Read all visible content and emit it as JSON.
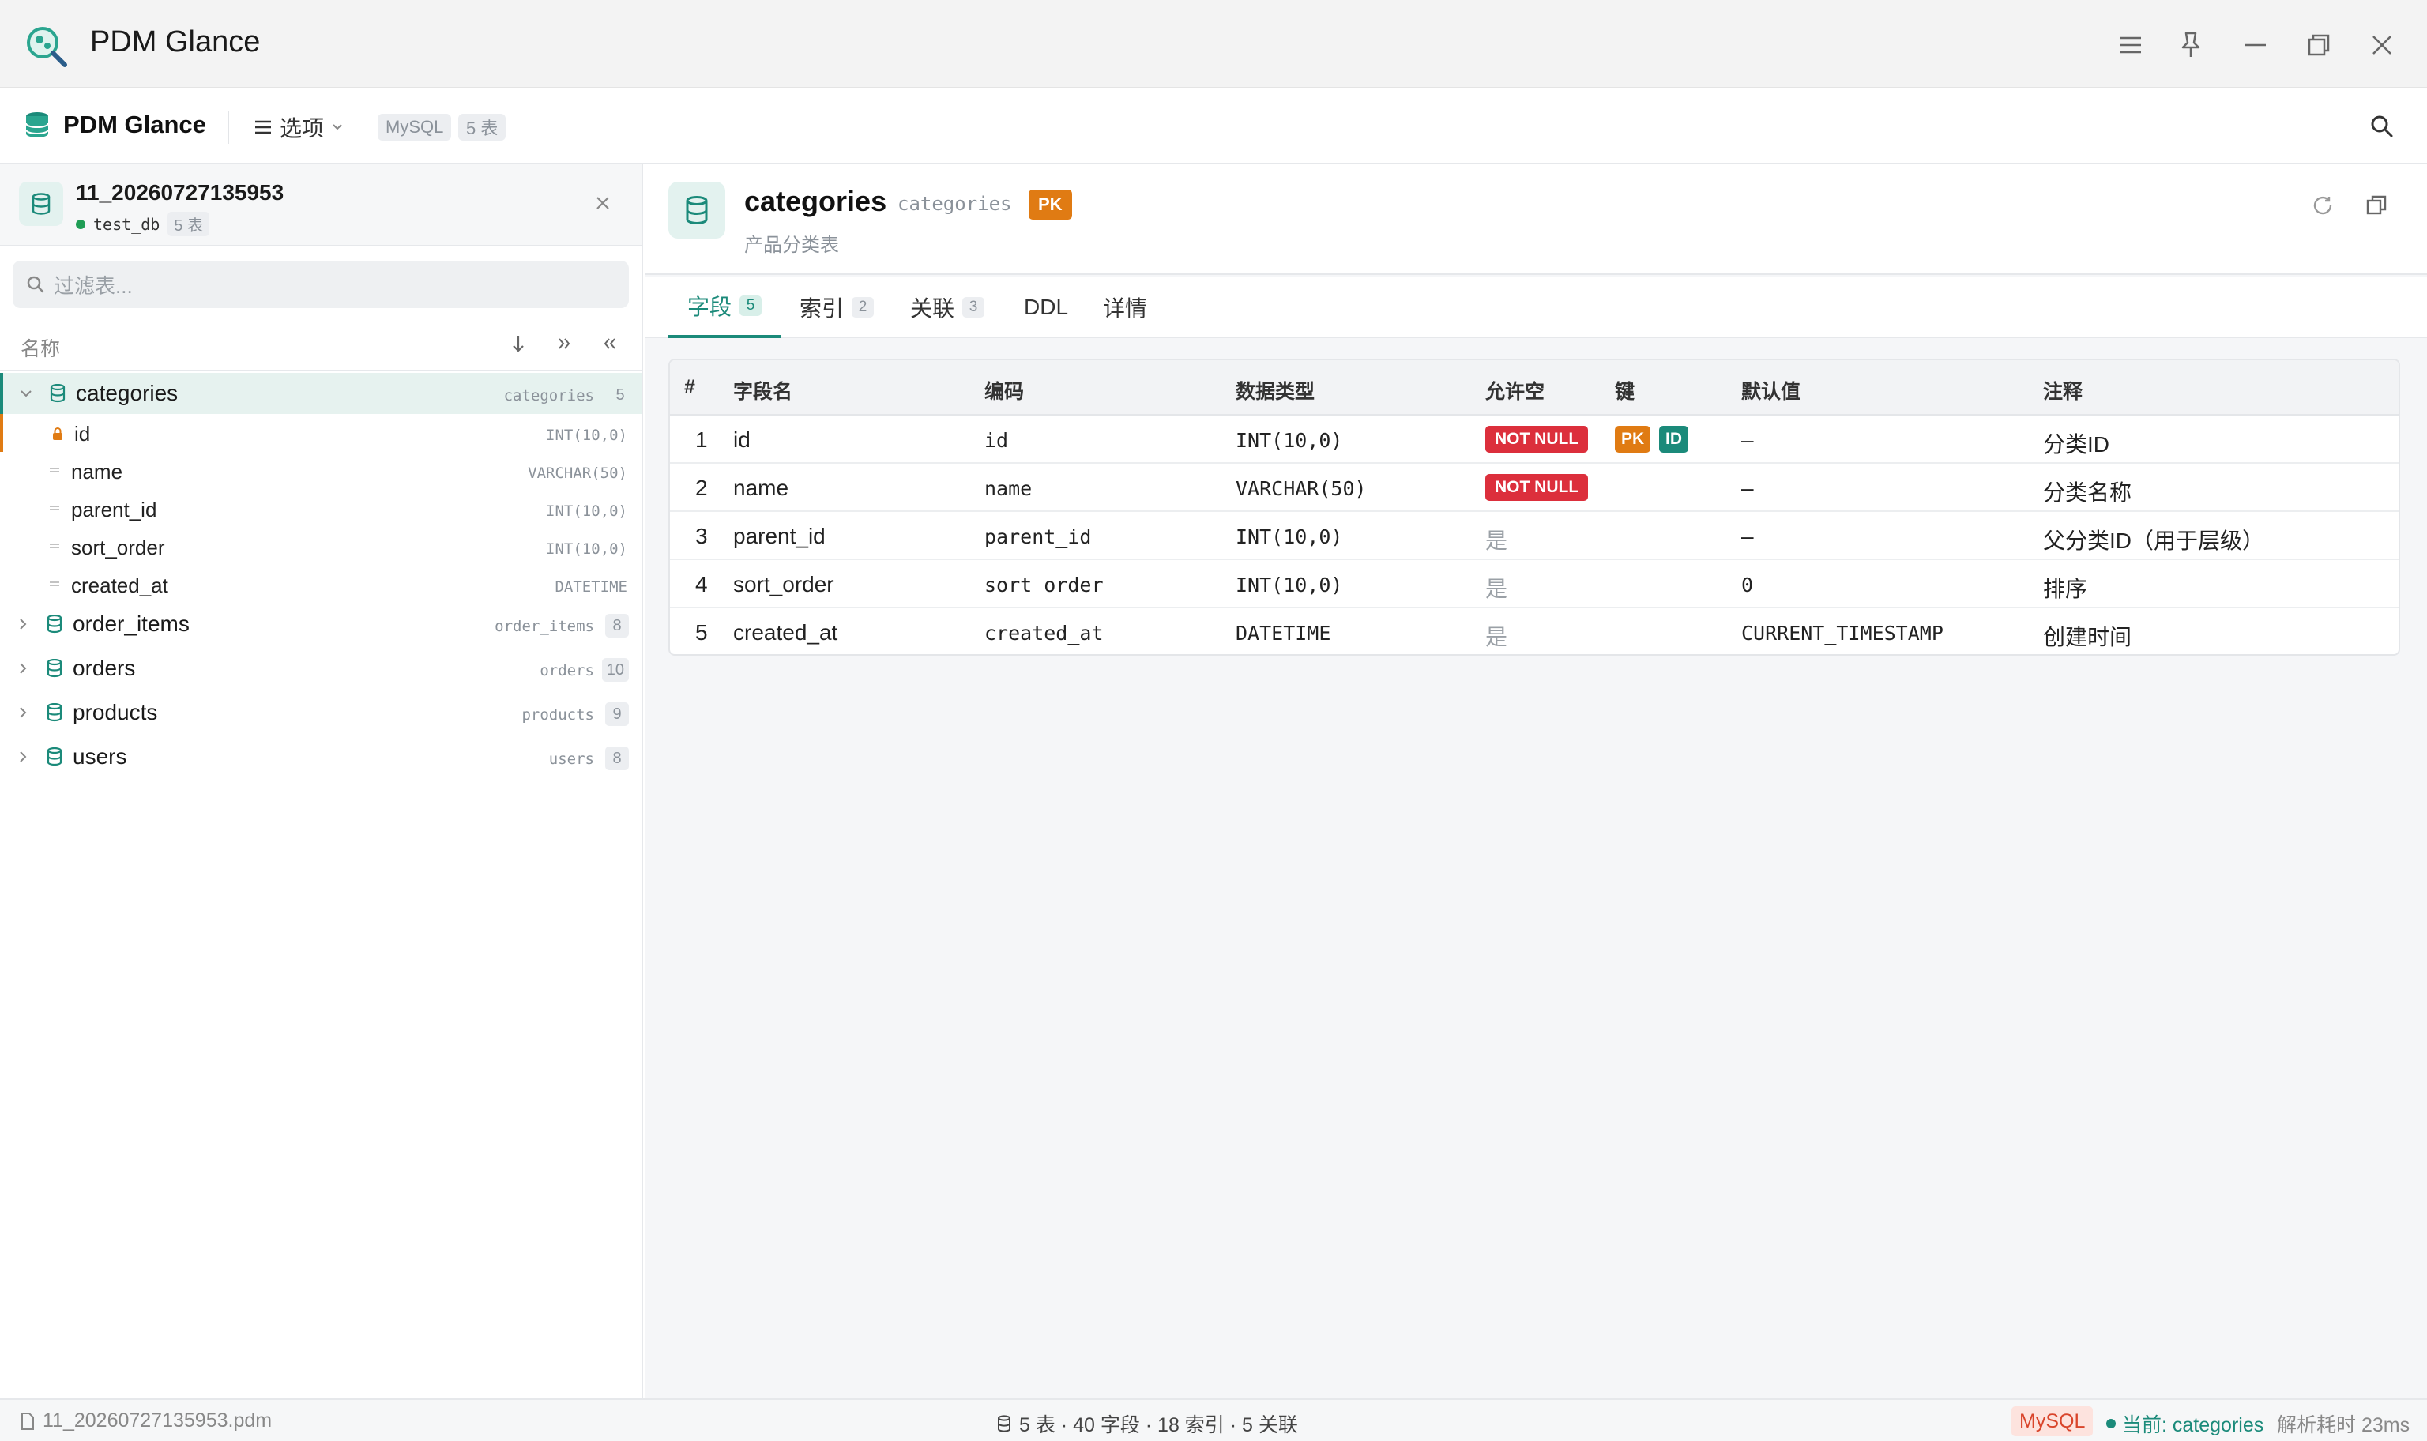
{
  "window": {
    "title": "PDM Glance"
  },
  "toolbar": {
    "brand": "PDM Glance",
    "options_label": "选项",
    "db_type": "MySQL",
    "table_count": "5 表"
  },
  "sidebar": {
    "file": {
      "name": "11_20260727135953",
      "db": "test_db",
      "tables": "5 表"
    },
    "filter_placeholder": "过滤表...",
    "list_header": "名称",
    "tables": [
      {
        "name": "categories",
        "code": "categories",
        "count": "5",
        "expanded": true,
        "fields": [
          {
            "name": "id",
            "type": "INT(10,0)",
            "pk": true
          },
          {
            "name": "name",
            "type": "VARCHAR(50)"
          },
          {
            "name": "parent_id",
            "type": "INT(10,0)"
          },
          {
            "name": "sort_order",
            "type": "INT(10,0)"
          },
          {
            "name": "created_at",
            "type": "DATETIME"
          }
        ]
      },
      {
        "name": "order_items",
        "code": "order_items",
        "count": "8"
      },
      {
        "name": "orders",
        "code": "orders",
        "count": "10"
      },
      {
        "name": "products",
        "code": "products",
        "count": "9"
      },
      {
        "name": "users",
        "code": "users",
        "count": "8"
      }
    ]
  },
  "main": {
    "title": "categories",
    "code": "categories",
    "pk_badge": "PK",
    "subtitle": "产品分类表",
    "tabs": [
      {
        "label": "字段",
        "count": "5",
        "active": true
      },
      {
        "label": "索引",
        "count": "2"
      },
      {
        "label": "关联",
        "count": "3"
      },
      {
        "label": "DDL"
      },
      {
        "label": "详情"
      }
    ],
    "columns": [
      "#",
      "字段名",
      "编码",
      "数据类型",
      "允许空",
      "键",
      "默认值",
      "注释"
    ],
    "rows": [
      {
        "n": "1",
        "name": "id",
        "code": "id",
        "type": "INT(10,0)",
        "nullable": "NOT NULL",
        "keys": [
          "PK",
          "ID"
        ],
        "default": "–",
        "comment": "分类ID"
      },
      {
        "n": "2",
        "name": "name",
        "code": "name",
        "type": "VARCHAR(50)",
        "nullable": "NOT NULL",
        "keys": [],
        "default": "–",
        "comment": "分类名称"
      },
      {
        "n": "3",
        "name": "parent_id",
        "code": "parent_id",
        "type": "INT(10,0)",
        "nullable": "是",
        "keys": [],
        "default": "–",
        "comment": "父分类ID（用于层级）"
      },
      {
        "n": "4",
        "name": "sort_order",
        "code": "sort_order",
        "type": "INT(10,0)",
        "nullable": "是",
        "keys": [],
        "default": "0",
        "comment": "排序"
      },
      {
        "n": "5",
        "name": "created_at",
        "code": "created_at",
        "type": "DATETIME",
        "nullable": "是",
        "keys": [],
        "default": "CURRENT_TIMESTAMP",
        "comment": "创建时间"
      }
    ]
  },
  "statusbar": {
    "file": "11_20260727135953.pdm",
    "stats": "5 表 · 40 字段 · 18 索引 · 5 关联",
    "db": "MySQL",
    "current": "当前: categories",
    "time": "解析耗时 23ms"
  },
  "colors": {
    "accent": "#1b8a7a",
    "pk": "#e07b13",
    "not_null": "#dc2f3c",
    "id_badge": "#1b8a7a"
  },
  "icons": [
    "app-logo-icon",
    "menu-icon",
    "pin-icon",
    "minimize-icon",
    "restore-icon",
    "close-icon",
    "database-icon",
    "search-icon",
    "refresh-icon",
    "copy-icon",
    "lock-icon",
    "file-icon"
  ]
}
